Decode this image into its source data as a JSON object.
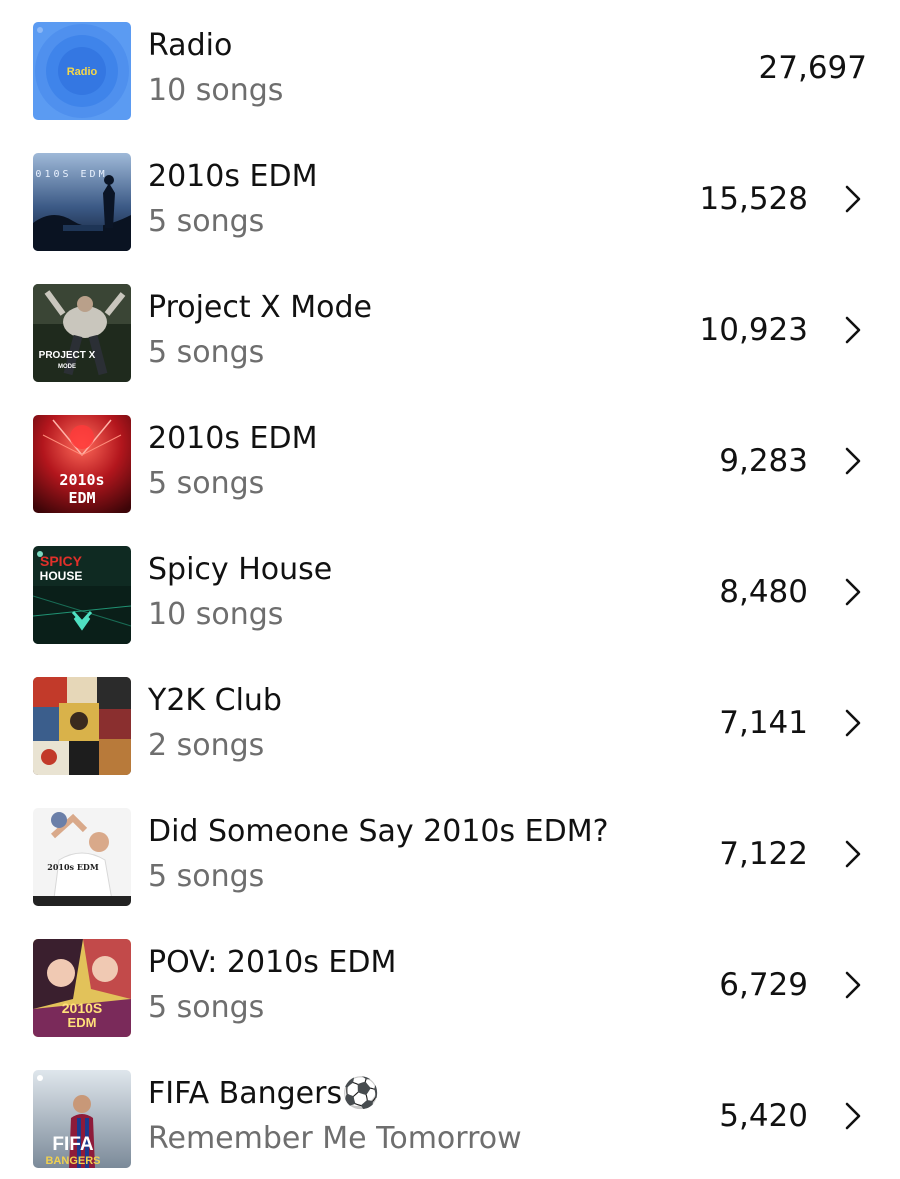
{
  "playlists": [
    {
      "title": "Radio",
      "subtitle": "10 songs",
      "count": "27,697",
      "cover_text": "Radio",
      "chevron": false,
      "cover_icon": "radio-cover"
    },
    {
      "title": "2010s EDM",
      "subtitle": "5 songs",
      "count": "15,528",
      "cover_text": "2010S EDM",
      "chevron": true,
      "cover_icon": "edm-crowd-cover"
    },
    {
      "title": "Project X Mode",
      "subtitle": "5 songs",
      "count": "10,923",
      "cover_text": "PROJECT X",
      "cover_subtext": "MODE",
      "chevron": true,
      "cover_icon": "party-person-cover"
    },
    {
      "title": "2010s EDM",
      "subtitle": "5 songs",
      "count": "9,283",
      "cover_text": "2010s",
      "cover_subtext": "EDM",
      "chevron": true,
      "cover_icon": "red-stage-cover"
    },
    {
      "title": "Spicy House",
      "subtitle": "10 songs",
      "count": "8,480",
      "cover_text": "SPICY",
      "cover_subtext": "HOUSE",
      "chevron": true,
      "cover_icon": "green-club-cover"
    },
    {
      "title": "Y2K Club",
      "subtitle": "2 songs",
      "count": "7,141",
      "chevron": true,
      "cover_icon": "collage-cover"
    },
    {
      "title": "Did Someone Say 2010s EDM?",
      "subtitle": "5 songs",
      "count": "7,122",
      "cover_text": "2010s EDM",
      "chevron": true,
      "cover_icon": "figure-cover"
    },
    {
      "title": "POV: 2010s EDM",
      "subtitle": "5 songs",
      "count": "6,729",
      "cover_text": "2010S",
      "cover_subtext": "EDM",
      "chevron": true,
      "cover_icon": "illustrated-cover"
    },
    {
      "title": "FIFA Bangers⚽",
      "subtitle": "Remember Me Tomorrow",
      "count": "5,420",
      "cover_text": "FIFA",
      "cover_subtext": "BANGERS",
      "chevron": true,
      "cover_icon": "football-cover"
    }
  ],
  "colors": {
    "title": "#111111",
    "subtitle": "#6e6e6e",
    "radio_blue": "#4a8ef0"
  }
}
